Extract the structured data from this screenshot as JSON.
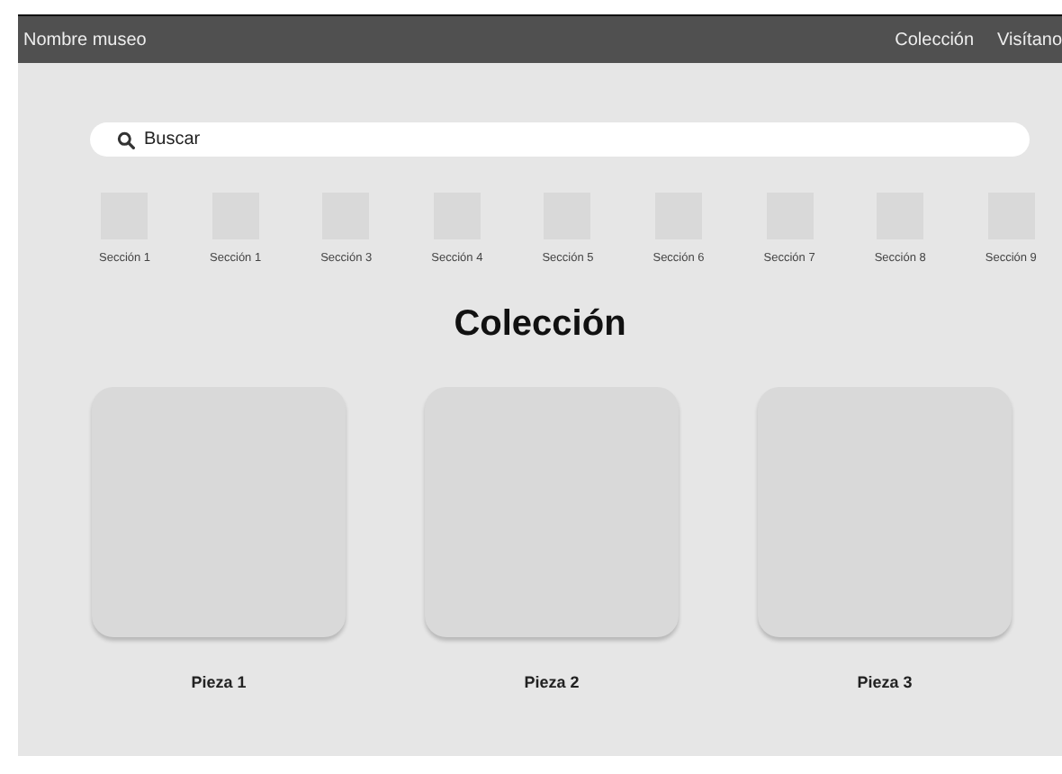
{
  "header": {
    "title": "Nombre museo",
    "nav": [
      "Colección",
      "Visítano"
    ]
  },
  "search": {
    "placeholder": "Buscar"
  },
  "sections": [
    "Sección 1",
    "Sección 1",
    "Sección 3",
    "Sección 4",
    "Sección 5",
    "Sección 6",
    "Sección 7",
    "Sección 8",
    "Sección 9"
  ],
  "heading": "Colección",
  "pieces": [
    "Pieza 1",
    "Pieza 2",
    "Pieza 3"
  ]
}
